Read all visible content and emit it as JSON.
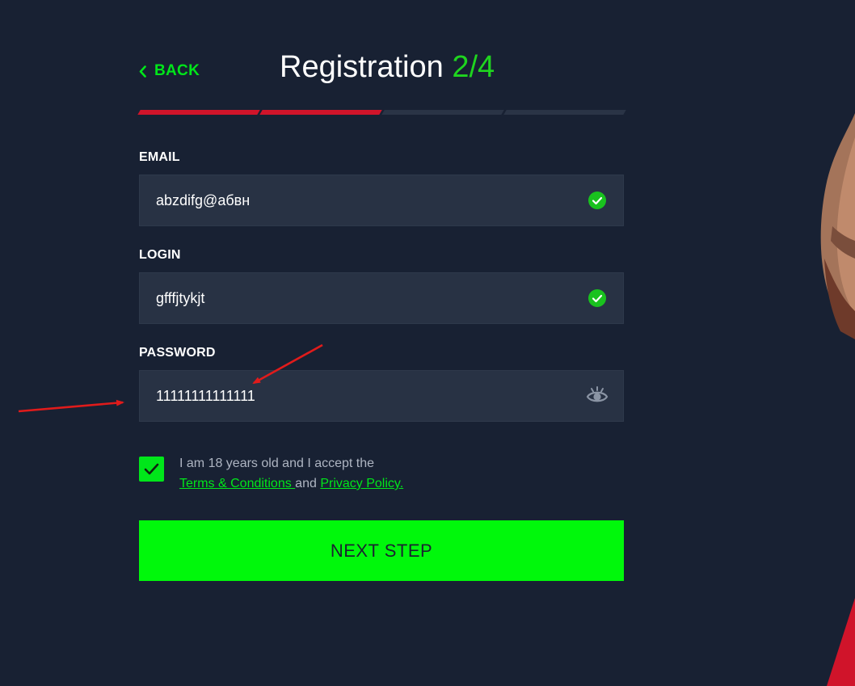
{
  "header": {
    "back_label": "BACK",
    "title": "Registration",
    "step": "2/4"
  },
  "progress": {
    "total_steps": 4,
    "completed_steps": 2,
    "active_color": "#d0142a",
    "inactive_color": "#2a3446"
  },
  "form": {
    "email": {
      "label": "EMAIL",
      "value": "abzdifg@абвн",
      "valid": true
    },
    "login": {
      "label": "LOGIN",
      "value": "gfffjtykjt",
      "valid": true
    },
    "password": {
      "label": "PASSWORD",
      "value": "11111111111111",
      "visibility_icon": "eye-icon"
    }
  },
  "terms": {
    "checked": true,
    "text_before": "I am 18 years old and I accept the",
    "terms_link": "Terms & Conditions ",
    "and_text": "and",
    "privacy_link": "Privacy Policy."
  },
  "next_button": {
    "label": "NEXT STEP"
  },
  "colors": {
    "background": "#182133",
    "field_background": "#283244",
    "accent_green": "#00f80b",
    "valid_green": "#19c21e",
    "annotation_red": "#e01b1b"
  }
}
